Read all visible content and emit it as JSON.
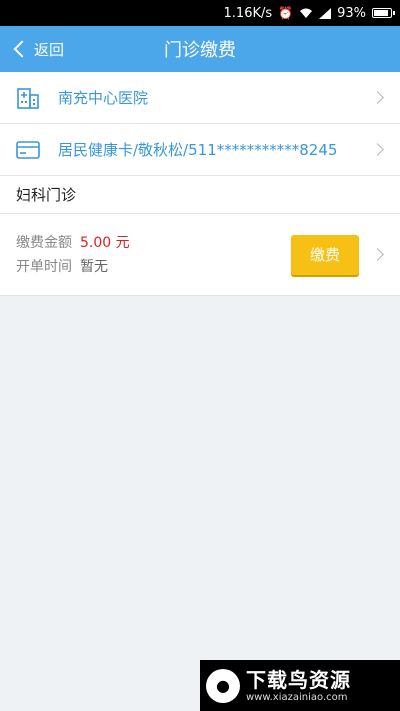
{
  "status_bar": {
    "speed": "1.16K/s",
    "battery": "93%",
    "icons": [
      "alarm-icon",
      "wifi-icon",
      "signal-icon",
      "battery-icon"
    ]
  },
  "nav": {
    "back_label": "返回",
    "title": "门诊缴费"
  },
  "hospital": {
    "name": "南充中心医院",
    "icon": "hospital-icon"
  },
  "patient_card": {
    "text": "居民健康卡/敬秋松/511***********8245",
    "icon": "card-icon"
  },
  "department": "妇科门诊",
  "fee": {
    "amount_label": "缴费金额",
    "amount_value": "5.00 元",
    "time_label": "开单时间",
    "time_value": "暂无",
    "pay_button": "缴费"
  },
  "watermark": {
    "title": "下载鸟资源",
    "url": "www.xiazainiao.com"
  },
  "colors": {
    "nav": "#4ba6ea",
    "link": "#3a97d8",
    "amount": "#e02020",
    "button": "#f6c015"
  }
}
